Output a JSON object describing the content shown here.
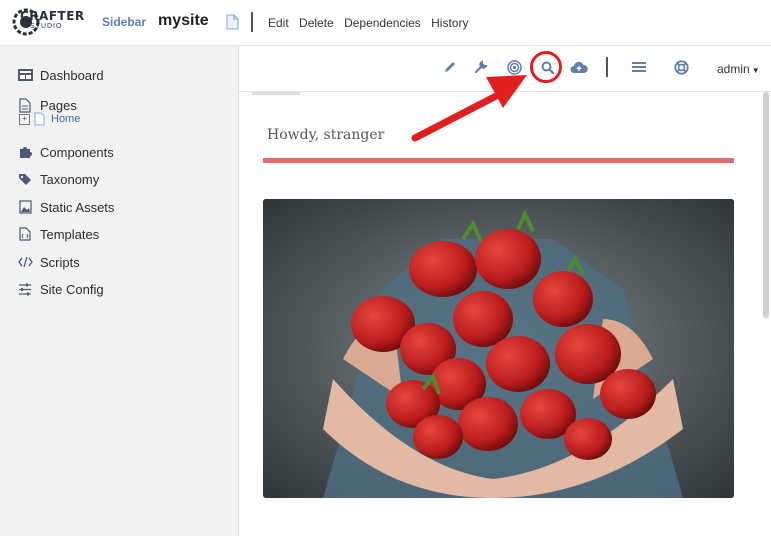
{
  "header": {
    "logo_text": "CRAFTER",
    "logo_subtext": "STUDIO",
    "sidebar_label": "Sidebar",
    "site_name": "mysite",
    "menu": [
      "Edit",
      "Delete",
      "Dependencies",
      "History"
    ]
  },
  "sidebar": {
    "items": [
      {
        "label": "Dashboard",
        "icon": "dashboard-icon"
      },
      {
        "label": "Pages",
        "icon": "pages-icon"
      },
      {
        "label": "Components",
        "icon": "puzzle-icon"
      },
      {
        "label": "Taxonomy",
        "icon": "tags-icon"
      },
      {
        "label": "Static Assets",
        "icon": "image-icon"
      },
      {
        "label": "Templates",
        "icon": "code-file-icon"
      },
      {
        "label": "Scripts",
        "icon": "code-icon"
      },
      {
        "label": "Site Config",
        "icon": "sliders-icon"
      }
    ],
    "pages_child": {
      "label": "Home",
      "expander": "⊞"
    }
  },
  "toolbar": {
    "icons": [
      "pencil-icon",
      "wrench-icon",
      "target-icon",
      "search-icon",
      "cloud-upload-icon",
      "menu-icon",
      "lifebuoy-icon"
    ],
    "user": "admin"
  },
  "preview": {
    "greeting": "Howdy, stranger",
    "accent_color": "#e86b6b"
  },
  "annotation": {
    "color": "#e21f1f"
  }
}
